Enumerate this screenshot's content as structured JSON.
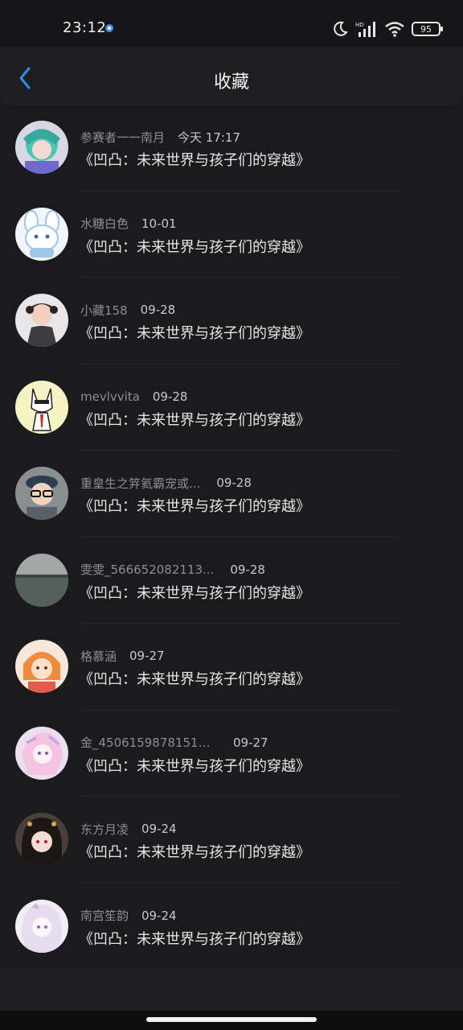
{
  "status_bar": {
    "time": "23:12",
    "battery": "95",
    "signal_label": "HD"
  },
  "header": {
    "title": "收藏"
  },
  "items": [
    {
      "name": "参赛者一一南月",
      "time": "今天 17:17",
      "work": "《凹凸：未来世界与孩子们的穿越》"
    },
    {
      "name": "水糖白色",
      "time": "10-01",
      "work": "《凹凸：未来世界与孩子们的穿越》"
    },
    {
      "name": "小藏158",
      "time": "09-28",
      "work": "《凹凸：未来世界与孩子们的穿越》"
    },
    {
      "name": "mevlvvita",
      "time": "09-28",
      "work": "《凹凸：未来世界与孩子们的穿越》"
    },
    {
      "name": "重皇生之笄氦霸宠或...",
      "time": "09-28",
      "work": "《凹凸：未来世界与孩子们的穿越》"
    },
    {
      "name": "雯雯_566652082113...",
      "time": "09-28",
      "work": "《凹凸：未来世界与孩子们的穿越》"
    },
    {
      "name": "格慕涵",
      "time": "09-27",
      "work": "《凹凸：未来世界与孩子们的穿越》"
    },
    {
      "name": "金_450615987815124...",
      "time": "09-27",
      "work": "《凹凸：未来世界与孩子们的穿越》"
    },
    {
      "name": "东方月凌",
      "time": "09-24",
      "work": "《凹凸：未来世界与孩子们的穿越》"
    },
    {
      "name": "南宫笙韵",
      "time": "09-24",
      "work": "《凹凸：未来世界与孩子们的穿越》"
    }
  ],
  "colors": {
    "background": "#1b1b1d",
    "accent": "#2f8cf0"
  }
}
